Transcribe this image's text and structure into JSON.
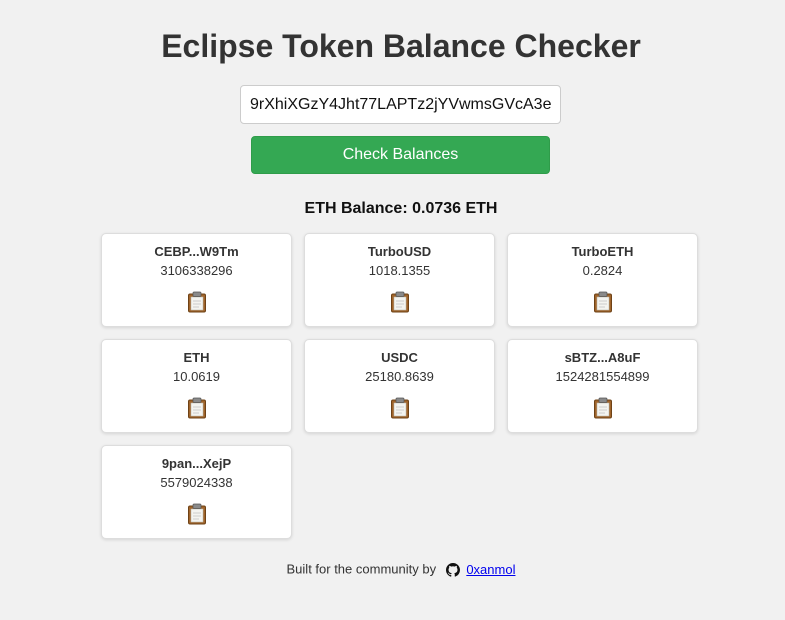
{
  "header": {
    "title": "Eclipse Token Balance Checker"
  },
  "form": {
    "address_value": "9rXhiXGzY4Jht77LAPTz2jYVwmsGVcA3e",
    "check_label": "Check Balances"
  },
  "eth_balance": "ETH Balance: 0.0736 ETH",
  "tokens": [
    {
      "name": "CEBP...W9Tm",
      "value": "3106338296",
      "icon": "clipboard-icon"
    },
    {
      "name": "TurboUSD",
      "value": "1018.1355",
      "icon": "clipboard-icon"
    },
    {
      "name": "TurboETH",
      "value": "0.2824",
      "icon": "clipboard-icon"
    },
    {
      "name": "ETH",
      "value": "10.0619",
      "icon": "clipboard-icon"
    },
    {
      "name": "USDC",
      "value": "25180.8639",
      "icon": "clipboard-icon"
    },
    {
      "name": "sBTZ...A8uF",
      "value": "1524281554899",
      "icon": "clipboard-icon"
    },
    {
      "name": "9pan...XejP",
      "value": "5579024338",
      "icon": "clipboard-icon"
    }
  ],
  "footer": {
    "text": "Built for the community by",
    "link_label": "0xanmol",
    "icon": "github-icon"
  },
  "colors": {
    "background": "#f1f1f1",
    "button": "#34a853",
    "link": "#0000ee"
  }
}
